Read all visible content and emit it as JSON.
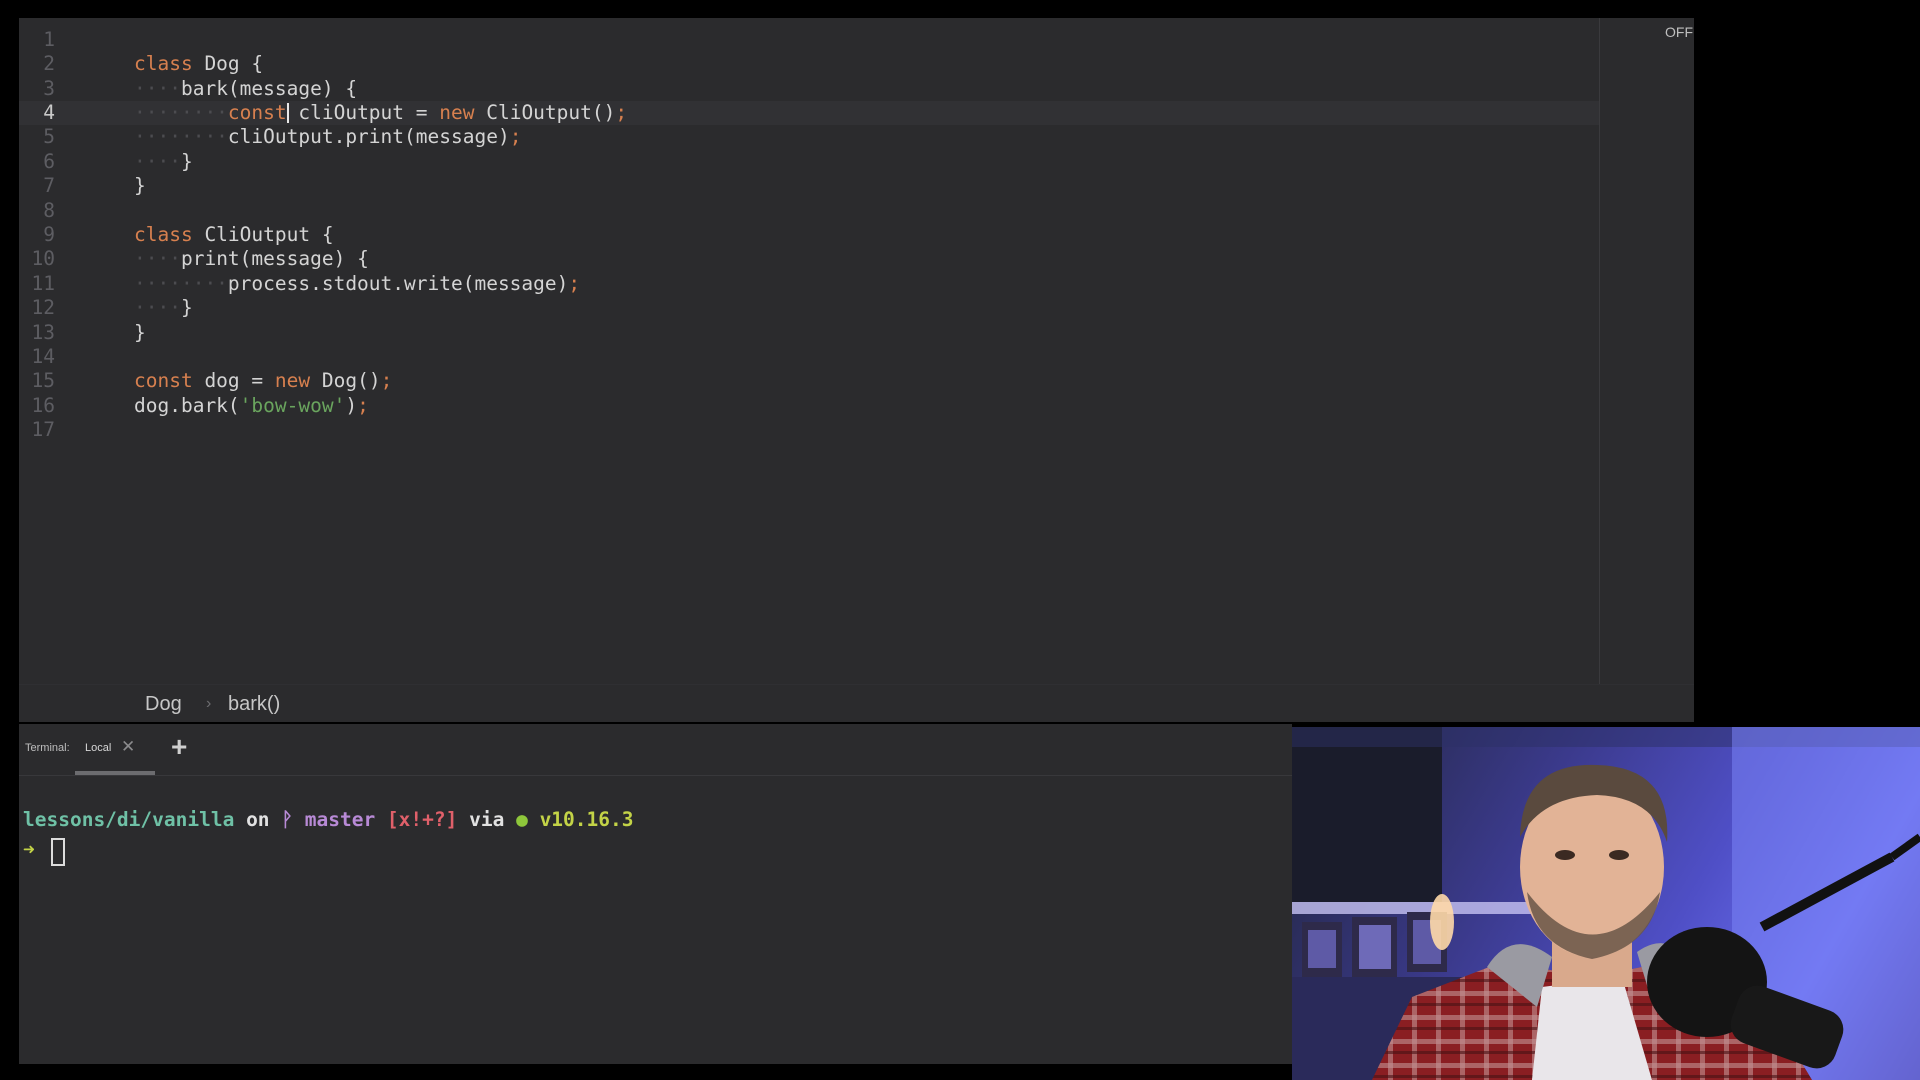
{
  "editor": {
    "off_label": "OFF",
    "current_line": 4,
    "lines": [
      {
        "n": "1",
        "indent": 0,
        "tokens": []
      },
      {
        "n": "2",
        "indent": 0,
        "tokens": [
          [
            "kw",
            "class"
          ],
          [
            "id",
            " Dog "
          ],
          [
            "punc",
            "{"
          ]
        ]
      },
      {
        "n": "3",
        "indent": 1,
        "tokens": [
          [
            "id",
            "bark(message) "
          ],
          [
            "punc",
            "{"
          ]
        ]
      },
      {
        "n": "4",
        "indent": 2,
        "tokens": [
          [
            "kw",
            "const"
          ],
          [
            "id",
            " cliOutput = "
          ],
          [
            "kw",
            "new"
          ],
          [
            "id",
            " CliOutput()"
          ],
          [
            "semi",
            ";"
          ]
        ]
      },
      {
        "n": "5",
        "indent": 2,
        "tokens": [
          [
            "id",
            "cliOutput.print(message)"
          ],
          [
            "semi",
            ";"
          ]
        ]
      },
      {
        "n": "6",
        "indent": 1,
        "tokens": [
          [
            "punc",
            "}"
          ]
        ]
      },
      {
        "n": "7",
        "indent": 0,
        "tokens": [
          [
            "punc",
            "}"
          ]
        ]
      },
      {
        "n": "8",
        "indent": 0,
        "tokens": []
      },
      {
        "n": "9",
        "indent": 0,
        "tokens": [
          [
            "kw",
            "class"
          ],
          [
            "id",
            " CliOutput "
          ],
          [
            "punc",
            "{"
          ]
        ]
      },
      {
        "n": "10",
        "indent": 1,
        "tokens": [
          [
            "id",
            "print(message) "
          ],
          [
            "punc",
            "{"
          ]
        ]
      },
      {
        "n": "11",
        "indent": 2,
        "tokens": [
          [
            "id",
            "process.stdout.write(message)"
          ],
          [
            "semi",
            ";"
          ]
        ]
      },
      {
        "n": "12",
        "indent": 1,
        "tokens": [
          [
            "punc",
            "}"
          ]
        ]
      },
      {
        "n": "13",
        "indent": 0,
        "tokens": [
          [
            "punc",
            "}"
          ]
        ]
      },
      {
        "n": "14",
        "indent": 0,
        "tokens": []
      },
      {
        "n": "15",
        "indent": 0,
        "tokens": [
          [
            "kw",
            "const"
          ],
          [
            "id",
            " dog = "
          ],
          [
            "kw",
            "new"
          ],
          [
            "id",
            " Dog()"
          ],
          [
            "semi",
            ";"
          ]
        ]
      },
      {
        "n": "16",
        "indent": 0,
        "tokens": [
          [
            "id",
            "dog.bark("
          ],
          [
            "str",
            "'bow-wow'"
          ],
          [
            "id",
            ")"
          ],
          [
            "semi",
            ";"
          ]
        ]
      },
      {
        "n": "17",
        "indent": 0,
        "tokens": []
      }
    ]
  },
  "breadcrumb": {
    "items": [
      "Dog",
      "bark()"
    ],
    "separator": "›"
  },
  "terminal": {
    "label": "Terminal:",
    "tab_label": "Local",
    "close_glyph": "✕",
    "add_glyph": "+",
    "prompt": {
      "path": "lessons/di/vanilla",
      "on": " on ",
      "branch_icon": "ᚹ",
      "branch": " master",
      "status": " [x!+?]",
      "via": " via ",
      "node_dot": "●",
      "node_version": " v10.16.3"
    },
    "arrow": "➜"
  },
  "colors": {
    "editor_bg": "#2b2b2d",
    "keyword": "#d7804f",
    "string": "#6aa55e",
    "path": "#6fc1a6",
    "branch": "#b88ad6",
    "status": "#e0606a",
    "node": "#c3d347"
  }
}
